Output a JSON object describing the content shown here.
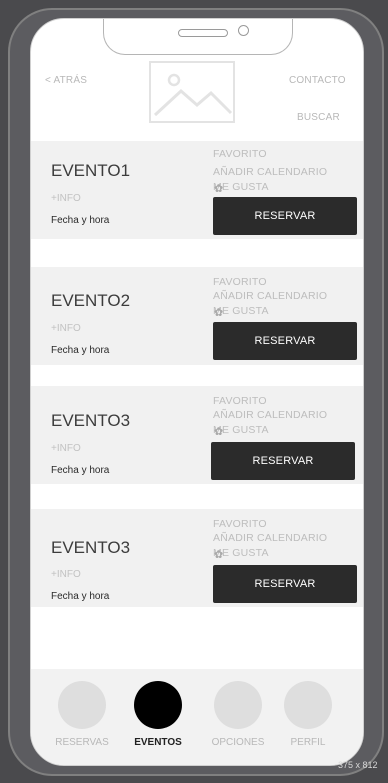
{
  "corner_label": "",
  "size_label": "375 x 812",
  "header": {
    "back_label": "< ATRÁS",
    "contact_label": "CONTACTO",
    "search_label": "BUSCAR"
  },
  "events": [
    {
      "title": "EVENTO1",
      "info": "+INFO",
      "date": "Fecha y hora",
      "favorite": "FAVORITO",
      "calendar": "AÑADIR CALENDARIO",
      "like": "ME GUSTA",
      "reserve": "RESERVAR"
    },
    {
      "title": "EVENTO2",
      "info": "+INFO",
      "date": "Fecha y hora",
      "favorite": "FAVORITO",
      "calendar": "AÑADIR CALENDARIO",
      "like": "ME GUSTA",
      "reserve": "RESERVAR"
    },
    {
      "title": "EVENTO3",
      "info": "+INFO",
      "date": "Fecha y hora",
      "favorite": "FAVORITO",
      "calendar": "AÑADIR CALENDARIO",
      "like": "ME GUSTA",
      "reserve": "RESERVAR"
    },
    {
      "title": "EVENTO3",
      "info": "+INFO",
      "date": "Fecha y hora",
      "favorite": "FAVORITO",
      "calendar": "AÑADIR CALENDARIO",
      "like": "ME GUSTA",
      "reserve": "RESERVAR"
    }
  ],
  "bottom_nav": [
    {
      "label": "RESERVAS",
      "active": false
    },
    {
      "label": "EVENTOS",
      "active": true
    },
    {
      "label": "OPCIONES",
      "active": false
    },
    {
      "label": "PERFIL",
      "active": false
    }
  ],
  "colors": {
    "background": "#4a4a4d",
    "card": "#f1f1f1",
    "button": "#2b2b2b",
    "active_nav": "#000000"
  }
}
